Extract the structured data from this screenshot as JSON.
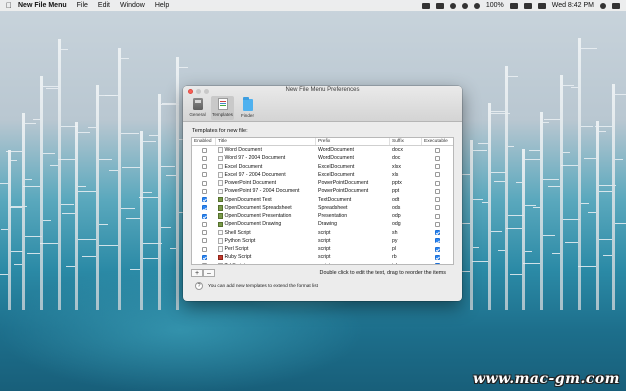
{
  "menubar": {
    "apple_icon": "apple-icon",
    "app_name": "New File Menu",
    "menus": [
      "File",
      "Edit",
      "Window",
      "Help"
    ],
    "battery": "100%",
    "datetime": "Wed 8:42 PM"
  },
  "window": {
    "title": "New File Menu Preferences",
    "toolbar": [
      {
        "label": "General",
        "icon": "general-icon"
      },
      {
        "label": "Templates",
        "icon": "templates-icon",
        "active": true
      },
      {
        "label": "Finder",
        "icon": "finder-folder-icon"
      }
    ],
    "section_label": "Templates for new file:",
    "columns": [
      "Enabled",
      "Title",
      "Prefix",
      "Suffix",
      "Executable"
    ],
    "rows": [
      {
        "enabled": false,
        "title": "Word Document",
        "prefix": "WordDocument",
        "suffix": "docx",
        "executable": false,
        "icon": "generic"
      },
      {
        "enabled": false,
        "title": "Word 97 - 2004 Document",
        "prefix": "WordDocument",
        "suffix": "doc",
        "executable": false,
        "icon": "generic"
      },
      {
        "enabled": false,
        "title": "Excel Document",
        "prefix": "ExcelDocument",
        "suffix": "xlsx",
        "executable": false,
        "icon": "generic"
      },
      {
        "enabled": false,
        "title": "Excel 97 - 2004 Document",
        "prefix": "ExcelDocument",
        "suffix": "xls",
        "executable": false,
        "icon": "generic"
      },
      {
        "enabled": false,
        "title": "PowerPoint Document",
        "prefix": "PowerPointDocument",
        "suffix": "pptx",
        "executable": false,
        "icon": "generic"
      },
      {
        "enabled": false,
        "title": "PowerPoint 97 - 2004 Document",
        "prefix": "PowerPointDocument",
        "suffix": "ppt",
        "executable": false,
        "icon": "generic"
      },
      {
        "enabled": true,
        "title": "OpenDocument Text",
        "prefix": "TextDocument",
        "suffix": "odt",
        "executable": false,
        "icon": "od"
      },
      {
        "enabled": true,
        "title": "OpenDocument Spreadsheet",
        "prefix": "Spreadsheet",
        "suffix": "ods",
        "executable": false,
        "icon": "od"
      },
      {
        "enabled": true,
        "title": "OpenDocument Presentation",
        "prefix": "Presentation",
        "suffix": "odp",
        "executable": false,
        "icon": "od"
      },
      {
        "enabled": false,
        "title": "OpenDocument Drawing",
        "prefix": "Drawing",
        "suffix": "odg",
        "executable": false,
        "icon": "od"
      },
      {
        "enabled": false,
        "title": "Shell Script",
        "prefix": "script",
        "suffix": "sh",
        "executable": true,
        "icon": "generic"
      },
      {
        "enabled": false,
        "title": "Python Script",
        "prefix": "script",
        "suffix": "py",
        "executable": true,
        "icon": "generic"
      },
      {
        "enabled": false,
        "title": "Perl Script",
        "prefix": "script",
        "suffix": "pl",
        "executable": true,
        "icon": "generic"
      },
      {
        "enabled": true,
        "title": "Ruby Script",
        "prefix": "script",
        "suffix": "rb",
        "executable": true,
        "icon": "rb"
      },
      {
        "enabled": false,
        "title": "Tcl Script",
        "prefix": "script",
        "suffix": "tcl",
        "executable": true,
        "icon": "generic"
      }
    ],
    "add_label": "+",
    "remove_label": "–",
    "hint": "Double click to edit the text, drag to reorder the items",
    "help_mark": "?",
    "help_text": "You can add new templates to extend the format list"
  },
  "watermark": "www.mac-gm.com",
  "colors": {
    "accent": "#2b86f3",
    "close": "#fc5f57"
  }
}
